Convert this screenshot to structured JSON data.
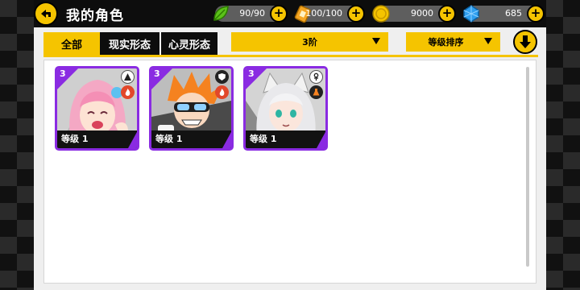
{
  "header": {
    "title": "我的角色"
  },
  "resources": [
    {
      "name": "stamina",
      "icon": "leaf-icon",
      "value": "90/90",
      "color": "#5cc21a"
    },
    {
      "name": "ticket",
      "icon": "ticket-icon",
      "value": "100/100",
      "color": "#f5a623"
    },
    {
      "name": "gold",
      "icon": "coin-icon",
      "value": "9000",
      "color": "#f5c400"
    },
    {
      "name": "diamond",
      "icon": "diamond-icon",
      "value": "685",
      "color": "#2f9ff0"
    }
  ],
  "tabs": [
    {
      "label": "全部",
      "active": true
    },
    {
      "label": "现实形态",
      "active": false
    },
    {
      "label": "心灵形态",
      "active": false
    }
  ],
  "filters": {
    "tier": "3阶",
    "sort": "等级排序"
  },
  "cards": [
    {
      "tier": "3",
      "level": "等级 1",
      "badges": [
        "triangle-icon",
        "fire-icon"
      ]
    },
    {
      "tier": "3",
      "level": "等级 1",
      "badges": [
        "shield-icon",
        "fire-icon"
      ]
    },
    {
      "tier": "3",
      "level": "等级 1",
      "badges": [
        "ankh-icon",
        "flask-icon"
      ]
    }
  ],
  "colors": {
    "accent": "#f5c400",
    "rarity": "#8a2be2",
    "background": "#efefef"
  }
}
